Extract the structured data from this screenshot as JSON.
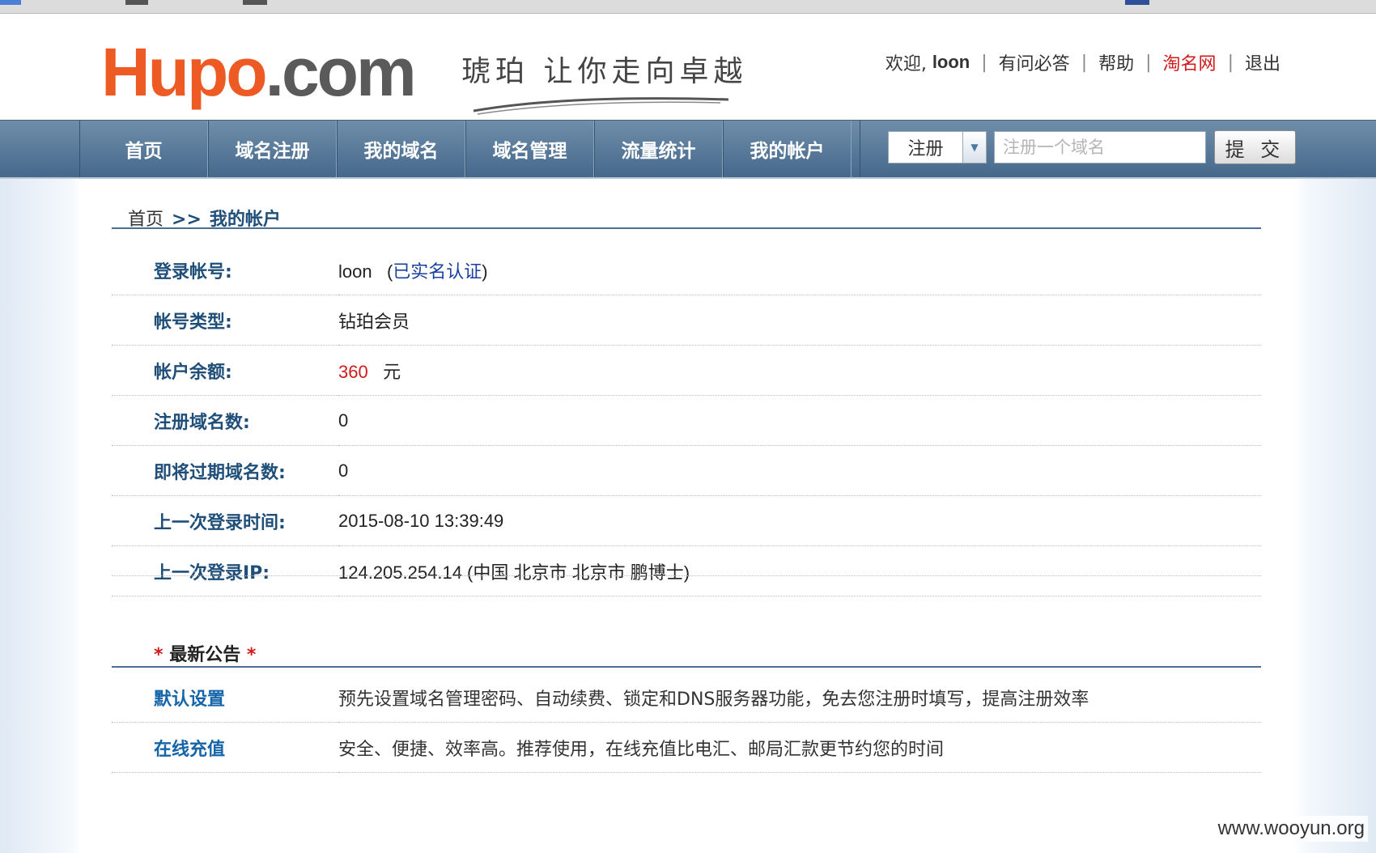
{
  "header": {
    "logo_part1": "Hu",
    "logo_part2": "po",
    "logo_part3": ".com",
    "slogan": "琥珀 让你走向卓越",
    "welcome_prefix": "欢迎,",
    "username": "loon",
    "links": [
      "有问必答",
      "帮助",
      "淘名网",
      "退出"
    ]
  },
  "nav": {
    "items": [
      "首页",
      "域名注册",
      "我的域名",
      "域名管理",
      "流量统计",
      "我的帐户"
    ],
    "select_value": "注册",
    "search_placeholder": "注册一个域名",
    "submit_label": "提 交"
  },
  "breadcrumb": {
    "home": "首页",
    "separator": ">>",
    "current": "我的帐户"
  },
  "account": {
    "login_label": "登录帐号:",
    "login_value": "loon",
    "verified_open": "(",
    "verified_text": "已实名认证",
    "verified_close": ")",
    "type_label": "帐号类型:",
    "type_value": "钻珀会员",
    "balance_label": "帐户余额:",
    "balance_value": "360",
    "balance_unit": "元",
    "domains_label": "注册域名数:",
    "domains_value": "0",
    "expiring_label": "即将过期域名数:",
    "expiring_value": "0",
    "last_login_label": "上一次登录时间:",
    "last_login_value": "2015-08-10 13:39:49",
    "last_ip_label": "上一次登录IP:",
    "last_ip_value": "124.205.254.14 (中国 北京市 北京市 鹏博士)"
  },
  "announcement": {
    "star": "*",
    "title": "最新公告"
  },
  "services": [
    {
      "label": "默认设置",
      "desc": "预先设置域名管理密码、自动续费、锁定和DNS服务器功能，免去您注册时填写，提高注册效率"
    },
    {
      "label": "在线充值",
      "desc": "安全、便捷、效率高。推荐使用，在线充值比电汇、邮局汇款更节约您的时间"
    }
  ],
  "watermark": "www.wooyun.org",
  "colors": {
    "nav_bg": "#45688b",
    "label_blue": "#1f4e79",
    "accent_red": "#d21a1a",
    "logo_orange": "#ee5a24"
  }
}
